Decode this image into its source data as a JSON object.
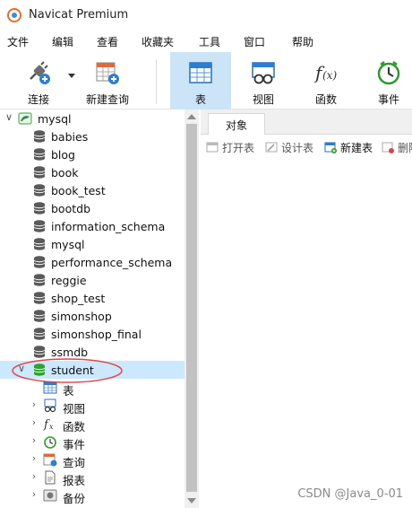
{
  "window": {
    "title": "Navicat Premium"
  },
  "menu": [
    "文件",
    "编辑",
    "查看",
    "收藏夹",
    "工具",
    "窗口",
    "帮助"
  ],
  "toolbar": {
    "connect_label": "连接",
    "new_query_label": "新建查询",
    "table_label": "表",
    "view_label": "视图",
    "function_label": "函数",
    "event_label": "事件"
  },
  "tree": {
    "connection": "mysql",
    "databases": [
      "babies",
      "blog",
      "book",
      "book_test",
      "bootdb",
      "information_schema",
      "mysql",
      "performance_schema",
      "reggie",
      "shop_test",
      "simonshop",
      "simonshop_final",
      "ssmdb",
      "student"
    ],
    "selected": "student",
    "children": [
      "表",
      "视图",
      "函数",
      "事件",
      "查询",
      "报表",
      "备份"
    ]
  },
  "panel": {
    "tab": "对象",
    "actions": {
      "open_table": "打开表",
      "design_table": "设计表",
      "new_table": "新建表",
      "delete_table": "删除"
    }
  },
  "watermark": "CSDN @Java_0-01",
  "colors": {
    "active_tool": "#cce4f7",
    "selected_row": "#cce8ff",
    "db_icon": "#5a5a5a",
    "selected_db_icon": "#2aa52a",
    "annotation": "#e04848"
  }
}
